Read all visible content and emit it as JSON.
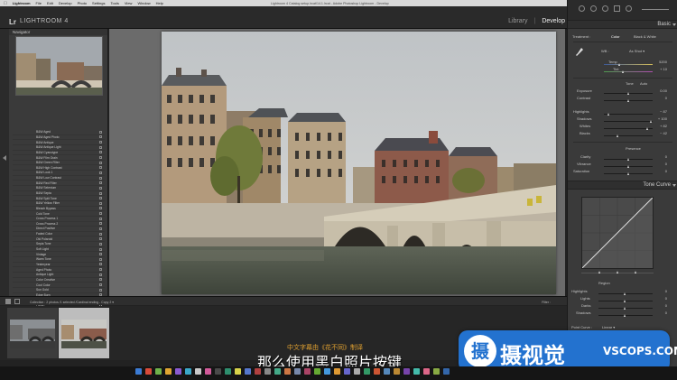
{
  "menubar": {
    "app": "Lightroom",
    "items": [
      "File",
      "Edit",
      "Develop",
      "Photo",
      "Settings",
      "Tools",
      "View",
      "Window",
      "Help"
    ],
    "doc_title": "Lightroom 4 Catalog setup.lrcat/14.1.lrcat - Adobe Photoshop Lightroom - Develop"
  },
  "lrbar": {
    "badge": "Lr",
    "title": "LIGHTROOM 4",
    "modules": [
      "Library",
      "Develop"
    ],
    "active_module": "Develop"
  },
  "left": {
    "navigator_label": "Navigator",
    "presets": [
      "B&W Aged",
      "B&W Aged Photo",
      "B&W Antique",
      "B&W Antique Light",
      "B&W Cyanotype",
      "B&W Film Grain",
      "B&W Green Filter",
      "B&W High Contrast",
      "B&W Look 1",
      "B&W Low Contrast",
      "B&W Red Filter",
      "B&W Selenium",
      "B&W Sepia",
      "B&W Split Tone",
      "B&W Yellow Filter",
      "Bleach Bypass",
      "Cold Tone",
      "Cross Process 1",
      "Cross Process 2",
      "Direct Positive",
      "Faded Color",
      "Old Polaroid",
      "Sepia Tone",
      "Soft Light",
      "Vintage",
      "Warm Tone",
      "Yesteryear",
      "Aged Photo",
      "Antique Light",
      "Color Creative",
      "Cool Color",
      "Sun Gold",
      "Edge Burn",
      "Warm Highlights",
      "Punch",
      "Clarity",
      "Sharpen",
      "Vignette",
      "Flat",
      "Matte",
      "Soft Fade"
    ],
    "copy_label": "Copy...",
    "paste_label": "Paste"
  },
  "filmstrip": {
    "info": "Collection : 2 photos /1 selected /Cardinal ending - Copy 2 ▾",
    "filter_label": "Filter :"
  },
  "right": {
    "basic_label": "Basic",
    "treatment_label": "Treatment :",
    "color_label": "Color",
    "bw_label": "Black & White",
    "wb_label": "WB :",
    "wb_value": "As Shot ▾",
    "temp_label": "Temp",
    "temp_value": "5200",
    "tint_label": "Tint",
    "tint_value": "+ 10",
    "tone_label": "Tone",
    "auto_label": "Auto",
    "exposure_label": "Exposure",
    "exposure_value": "0.00",
    "contrast_label": "Contrast",
    "contrast_value": "0",
    "highlights_label": "Highlights",
    "highlights_value": "− 87",
    "shadows_label": "Shadows",
    "shadows_value": "+ 100",
    "whites_label": "Whites",
    "whites_value": "+ 82",
    "blacks_label": "Blacks",
    "blacks_value": "− 42",
    "presence_label": "Presence",
    "clarity_label": "Clarity",
    "clarity_value": "0",
    "vibrance_label": "Vibrance",
    "vibrance_value": "0",
    "saturation_label": "Saturation",
    "saturation_value": "0",
    "tone_curve_label": "Tone Curve",
    "region_label": "Region",
    "hl_label": "Highlights",
    "hl_value": "0",
    "lights_label": "Lights",
    "lights_value": "0",
    "darks_label": "Darks",
    "darks_value": "0",
    "shadows2_label": "Shadows",
    "shadows2_value": "0",
    "point_curve_label": "Point Curve :",
    "point_curve_value": "Linear ▾"
  },
  "subtitle": {
    "line1": "中文字幕由《花不同》制译",
    "line2": "那么使用黑白照片按键"
  },
  "watermark": {
    "logo_char": "摄",
    "name": "摄视觉",
    "site": "VSCOPS.COM"
  }
}
